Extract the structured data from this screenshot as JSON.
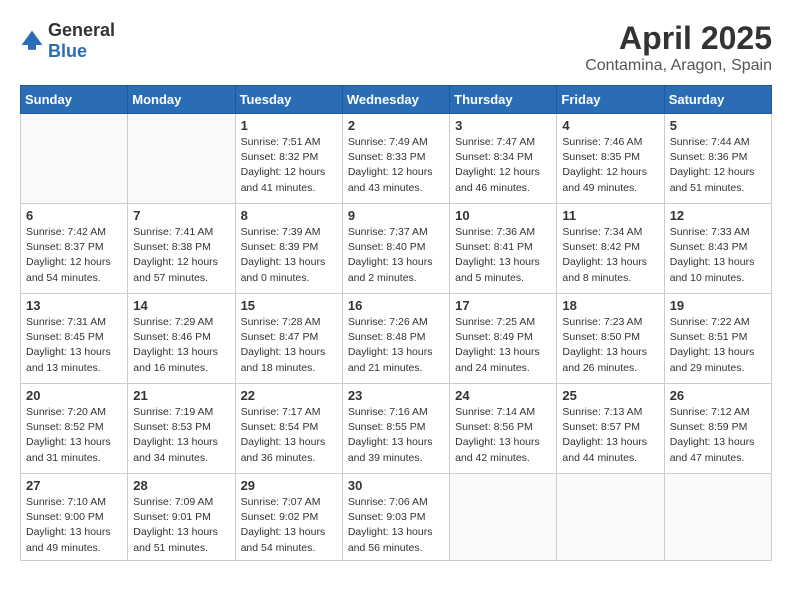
{
  "logo": {
    "text_general": "General",
    "text_blue": "Blue"
  },
  "title": "April 2025",
  "location": "Contamina, Aragon, Spain",
  "days_of_week": [
    "Sunday",
    "Monday",
    "Tuesday",
    "Wednesday",
    "Thursday",
    "Friday",
    "Saturday"
  ],
  "weeks": [
    [
      {
        "day": null,
        "info": null
      },
      {
        "day": null,
        "info": null
      },
      {
        "day": "1",
        "info": "Sunrise: 7:51 AM\nSunset: 8:32 PM\nDaylight: 12 hours and 41 minutes."
      },
      {
        "day": "2",
        "info": "Sunrise: 7:49 AM\nSunset: 8:33 PM\nDaylight: 12 hours and 43 minutes."
      },
      {
        "day": "3",
        "info": "Sunrise: 7:47 AM\nSunset: 8:34 PM\nDaylight: 12 hours and 46 minutes."
      },
      {
        "day": "4",
        "info": "Sunrise: 7:46 AM\nSunset: 8:35 PM\nDaylight: 12 hours and 49 minutes."
      },
      {
        "day": "5",
        "info": "Sunrise: 7:44 AM\nSunset: 8:36 PM\nDaylight: 12 hours and 51 minutes."
      }
    ],
    [
      {
        "day": "6",
        "info": "Sunrise: 7:42 AM\nSunset: 8:37 PM\nDaylight: 12 hours and 54 minutes."
      },
      {
        "day": "7",
        "info": "Sunrise: 7:41 AM\nSunset: 8:38 PM\nDaylight: 12 hours and 57 minutes."
      },
      {
        "day": "8",
        "info": "Sunrise: 7:39 AM\nSunset: 8:39 PM\nDaylight: 13 hours and 0 minutes."
      },
      {
        "day": "9",
        "info": "Sunrise: 7:37 AM\nSunset: 8:40 PM\nDaylight: 13 hours and 2 minutes."
      },
      {
        "day": "10",
        "info": "Sunrise: 7:36 AM\nSunset: 8:41 PM\nDaylight: 13 hours and 5 minutes."
      },
      {
        "day": "11",
        "info": "Sunrise: 7:34 AM\nSunset: 8:42 PM\nDaylight: 13 hours and 8 minutes."
      },
      {
        "day": "12",
        "info": "Sunrise: 7:33 AM\nSunset: 8:43 PM\nDaylight: 13 hours and 10 minutes."
      }
    ],
    [
      {
        "day": "13",
        "info": "Sunrise: 7:31 AM\nSunset: 8:45 PM\nDaylight: 13 hours and 13 minutes."
      },
      {
        "day": "14",
        "info": "Sunrise: 7:29 AM\nSunset: 8:46 PM\nDaylight: 13 hours and 16 minutes."
      },
      {
        "day": "15",
        "info": "Sunrise: 7:28 AM\nSunset: 8:47 PM\nDaylight: 13 hours and 18 minutes."
      },
      {
        "day": "16",
        "info": "Sunrise: 7:26 AM\nSunset: 8:48 PM\nDaylight: 13 hours and 21 minutes."
      },
      {
        "day": "17",
        "info": "Sunrise: 7:25 AM\nSunset: 8:49 PM\nDaylight: 13 hours and 24 minutes."
      },
      {
        "day": "18",
        "info": "Sunrise: 7:23 AM\nSunset: 8:50 PM\nDaylight: 13 hours and 26 minutes."
      },
      {
        "day": "19",
        "info": "Sunrise: 7:22 AM\nSunset: 8:51 PM\nDaylight: 13 hours and 29 minutes."
      }
    ],
    [
      {
        "day": "20",
        "info": "Sunrise: 7:20 AM\nSunset: 8:52 PM\nDaylight: 13 hours and 31 minutes."
      },
      {
        "day": "21",
        "info": "Sunrise: 7:19 AM\nSunset: 8:53 PM\nDaylight: 13 hours and 34 minutes."
      },
      {
        "day": "22",
        "info": "Sunrise: 7:17 AM\nSunset: 8:54 PM\nDaylight: 13 hours and 36 minutes."
      },
      {
        "day": "23",
        "info": "Sunrise: 7:16 AM\nSunset: 8:55 PM\nDaylight: 13 hours and 39 minutes."
      },
      {
        "day": "24",
        "info": "Sunrise: 7:14 AM\nSunset: 8:56 PM\nDaylight: 13 hours and 42 minutes."
      },
      {
        "day": "25",
        "info": "Sunrise: 7:13 AM\nSunset: 8:57 PM\nDaylight: 13 hours and 44 minutes."
      },
      {
        "day": "26",
        "info": "Sunrise: 7:12 AM\nSunset: 8:59 PM\nDaylight: 13 hours and 47 minutes."
      }
    ],
    [
      {
        "day": "27",
        "info": "Sunrise: 7:10 AM\nSunset: 9:00 PM\nDaylight: 13 hours and 49 minutes."
      },
      {
        "day": "28",
        "info": "Sunrise: 7:09 AM\nSunset: 9:01 PM\nDaylight: 13 hours and 51 minutes."
      },
      {
        "day": "29",
        "info": "Sunrise: 7:07 AM\nSunset: 9:02 PM\nDaylight: 13 hours and 54 minutes."
      },
      {
        "day": "30",
        "info": "Sunrise: 7:06 AM\nSunset: 9:03 PM\nDaylight: 13 hours and 56 minutes."
      },
      {
        "day": null,
        "info": null
      },
      {
        "day": null,
        "info": null
      },
      {
        "day": null,
        "info": null
      }
    ]
  ]
}
